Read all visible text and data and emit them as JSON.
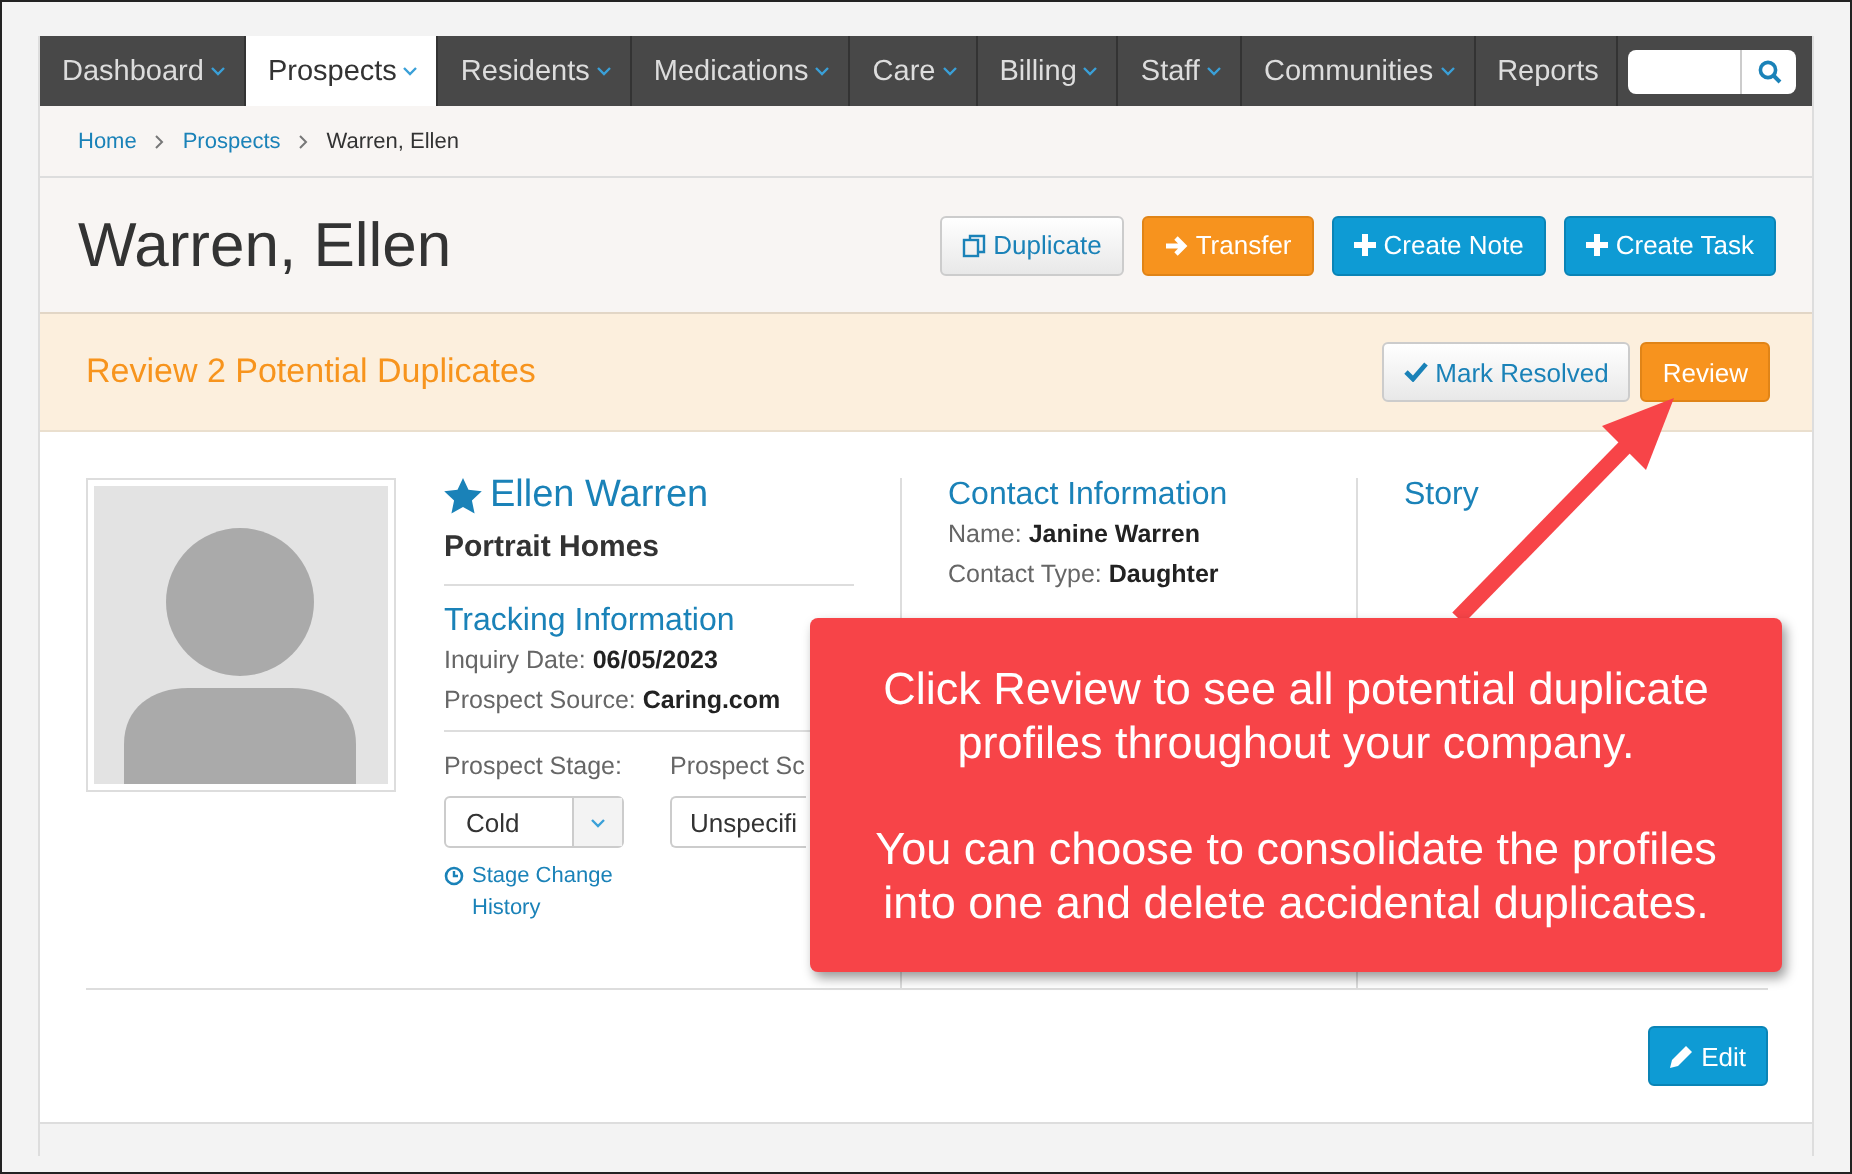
{
  "nav": {
    "items": [
      {
        "label": "Dashboard",
        "caret": true,
        "selected": false
      },
      {
        "label": "Prospects",
        "caret": true,
        "selected": true
      },
      {
        "label": "Residents",
        "caret": true,
        "selected": false
      },
      {
        "label": "Medications",
        "caret": true,
        "selected": false
      },
      {
        "label": "Care",
        "caret": true,
        "selected": false
      },
      {
        "label": "Billing",
        "caret": true,
        "selected": false
      },
      {
        "label": "Staff",
        "caret": true,
        "selected": false
      },
      {
        "label": "Communities",
        "caret": true,
        "selected": false
      },
      {
        "label": "Reports",
        "caret": false,
        "selected": false
      }
    ]
  },
  "breadcrumb": [
    "Home",
    "Prospects",
    "Warren, Ellen"
  ],
  "header": {
    "title": "Warren, Ellen",
    "buttons": [
      {
        "label": "Duplicate",
        "kind": "default"
      },
      {
        "label": "Transfer",
        "kind": "warning"
      },
      {
        "label": "Create Note",
        "kind": "primary"
      },
      {
        "label": "Create Task",
        "kind": "primary"
      }
    ]
  },
  "banner": {
    "title": "Review 2 Potential Duplicates",
    "buttons": [
      {
        "label": "Mark Resolved",
        "kind": "default"
      },
      {
        "label": "Review",
        "kind": "warning"
      }
    ]
  },
  "profile": {
    "name": "Ellen Warren",
    "favorite": true,
    "community": "Portrait Homes",
    "tracking_title": "Tracking Information",
    "tracking": [
      {
        "label": "Inquiry Date:",
        "value": "06/05/2023"
      },
      {
        "label": "Prospect Source:",
        "value": "Caring.com"
      }
    ],
    "selects": [
      {
        "label": "Prospect Stage:",
        "value": "Cold"
      },
      {
        "label": "Prospect Sc",
        "value": "Unspecifi"
      }
    ],
    "history_link": "Stage Change History"
  },
  "contact": {
    "title": "Contact Information",
    "fields": [
      {
        "label": "Name:",
        "value": "Janine Warren"
      },
      {
        "label": "Contact Type:",
        "value": "Daughter"
      }
    ]
  },
  "story": {
    "title": "Story"
  },
  "edit_button": "Edit",
  "callout": {
    "paragraphs": [
      "Click Review to see all potential duplicate profiles throughout your company.",
      "You can choose to consolidate the profiles into one and delete accidental duplicates."
    ]
  }
}
